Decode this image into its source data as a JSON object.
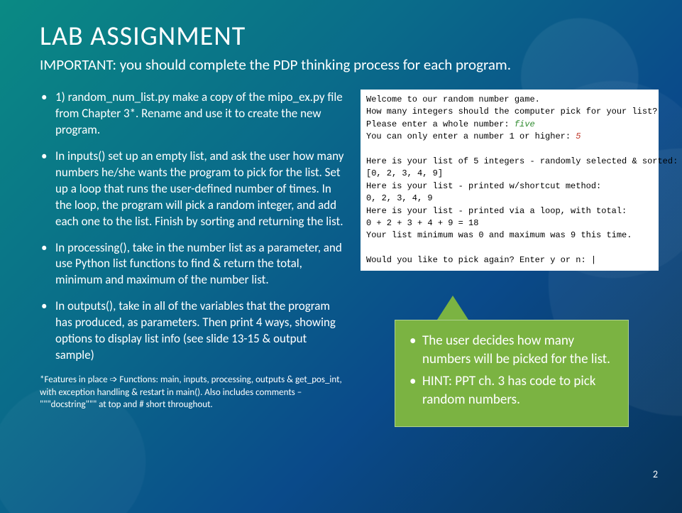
{
  "title": "LAB ASSIGNMENT",
  "subtitle": "IMPORTANT: you should complete the PDP thinking process for each program.",
  "bullets": [
    "1) random_num_list.py  make a copy of the mipo_ex.py file from Chapter 3*. Rename and use it to create the new program.",
    "In inputs() set up an empty list, and ask the user how many numbers he/she wants the program to pick for the list. Set up a loop that runs the user-defined number of times. In the loop, the program will pick a random integer, and add each one to the list. Finish by sorting and returning the list.",
    "In processing(),  take in the number list as a parameter, and use Python list functions to find & return the total, minimum and maximum of the number list.",
    "In outputs(), take in all of the variables that the program has produced, as parameters. Then print 4 ways, showing options to display list info (see slide 13-15 & output sample)"
  ],
  "footnote": "*Features in place ➩ Functions: main, inputs, processing, outputs & get_pos_int, with exception handling & restart in main(). Also includes comments – \"\"\"docstring\"\"\" at top and # short throughout.",
  "console": {
    "l1": "Welcome to our random number game.",
    "l2": "How many integers should the computer pick for your list?",
    "l3a": "Please enter a whole number: ",
    "l3b": "five",
    "l4a": "You can only enter a number 1 or higher: ",
    "l4b": "5",
    "blank1": "",
    "l5": "Here is your list of 5 integers - randomly selected & sorted:",
    "l6": "[0, 2, 3, 4, 9]",
    "l7": "Here is your list - printed w/shortcut method:",
    "l8": "0, 2, 3, 4, 9",
    "l9": "Here is your list - printed via a loop, with total:",
    "l10": "0 + 2 + 3 + 4 + 9 = 18",
    "l11": "Your list minimum was 0 and maximum was 9 this time.",
    "blank2": "",
    "l12": "Would you like to pick again? Enter y or n: |"
  },
  "callout": [
    "The user decides how many numbers will be picked for the list.",
    "HINT: PPT ch. 3 has code to pick random numbers."
  ],
  "page_number": "2"
}
